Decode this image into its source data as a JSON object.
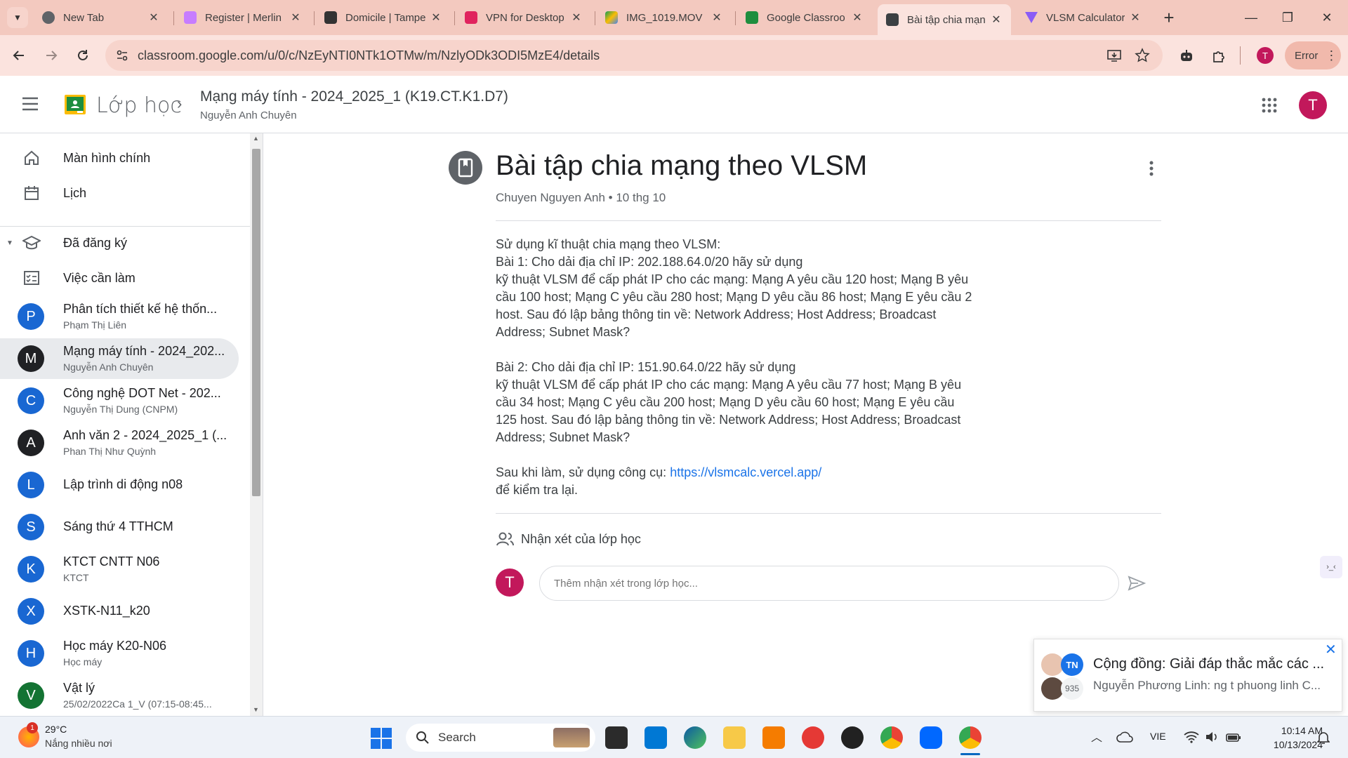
{
  "browser": {
    "tabs": [
      {
        "title": "New Tab",
        "color": "#5f6368"
      },
      {
        "title": "Register | Merlin",
        "color": "#c77dff"
      },
      {
        "title": "Domicile | Tampe",
        "color": "#333333"
      },
      {
        "title": "VPN for Desktop",
        "color": "#e0245e"
      },
      {
        "title": "IMG_1019.MOV",
        "color": "#fbbc04"
      },
      {
        "title": "Google Classroo",
        "color": "#1e8e3e"
      },
      {
        "title": "Bài tập chia mạn",
        "color": "#3c4043"
      },
      {
        "title": "VLSM Calculator",
        "color": "#8a5cf6"
      }
    ],
    "url": "classroom.google.com/u/0/c/NzEyNTI0NTk1OTMw/m/NzlyODk3ODI5MzE4/details",
    "profile_initial": "T",
    "error_label": "Error"
  },
  "header": {
    "brand": "Lớp học",
    "course_title": "Mạng máy tính - 2024_2025_1 (K19.CT.K1.D7)",
    "course_teacher": "Nguyễn Anh Chuyên",
    "user_initial": "T"
  },
  "sidebar": {
    "home": "Màn hình chính",
    "calendar": "Lịch",
    "enrolled": "Đã đăng ký",
    "todo": "Việc cần làm",
    "courses": [
      {
        "letter": "P",
        "name": "Phân tích thiết kế hệ thốn...",
        "teacher": "Phạm Thị Liên",
        "color": "#1967d2"
      },
      {
        "letter": "M",
        "name": "Mạng máy tính - 2024_202...",
        "teacher": "Nguyễn Anh Chuyên",
        "color": "#202124"
      },
      {
        "letter": "C",
        "name": "Công nghệ DOT Net - 202...",
        "teacher": "Nguyễn Thị Dung (CNPM)",
        "color": "#1967d2"
      },
      {
        "letter": "A",
        "name": "Anh văn 2 - 2024_2025_1 (...",
        "teacher": "Phan Thị Như Quỳnh",
        "color": "#202124"
      },
      {
        "letter": "L",
        "name": "Lập trình di động n08",
        "teacher": "",
        "color": "#1967d2"
      },
      {
        "letter": "S",
        "name": "Sáng thứ 4 TTHCM",
        "teacher": "",
        "color": "#1967d2"
      },
      {
        "letter": "K",
        "name": "KTCT CNTT N06",
        "teacher": "KTCT",
        "color": "#1967d2"
      },
      {
        "letter": "X",
        "name": "XSTK-N11_k20",
        "teacher": "",
        "color": "#1967d2"
      },
      {
        "letter": "H",
        "name": "Học máy K20-N06",
        "teacher": "Học máy",
        "color": "#1967d2"
      },
      {
        "letter": "V",
        "name": "Vật lý",
        "teacher": "25/02/2022Ca 1_V (07:15-08:45...",
        "color": "#137333"
      }
    ]
  },
  "assignment": {
    "title": "Bài tập chia mạng theo VLSM",
    "meta": "Chuyen Nguyen Anh • 10 thg 10",
    "intro": "Sử dụng kĩ thuật chia mạng theo VLSM:",
    "p1_line1": "Bài 1: Cho dải địa chỉ IP: 202.188.64.0/20 hãy sử dụng",
    "p1_line2": "kỹ thuật VLSM để cấp phát IP cho các mạng: Mạng A yêu cầu 120 host; Mạng B yêu cầu 100 host; Mạng C yêu cầu 280 host; Mạng D yêu cầu 86 host; Mạng E yêu cầu 2 host. Sau đó lập bảng thông tin về: Network Address; Host Address; Broadcast Address; Subnet Mask?",
    "p2_line1": "Bài 2: Cho dải địa chỉ IP: 151.90.64.0/22 hãy sử dụng",
    "p2_line2": "kỹ thuật VLSM để cấp phát IP cho các mạng: Mạng A yêu cầu 77 host; Mạng B yêu cầu 34 host; Mạng C yêu cầu 200 host; Mạng D yêu cầu 60 host; Mạng E yêu cầu 125 host. Sau đó lập bảng thông tin về: Network Address; Host Address; Broadcast Address; Subnet Mask?",
    "tool_prefix": "Sau khi làm, sử dụng công cụ: ",
    "tool_link": "https://vlsmcalc.vercel.app/",
    "tool_suffix": "để kiểm tra lại.",
    "comments_heading": "Nhận xét của lớp học",
    "comment_placeholder": "Thêm nhận xét trong lớp học...",
    "commenter_initial": "T"
  },
  "notification": {
    "title": "Cộng đồng: Giải đáp thắc mắc các ...",
    "message": "Nguyễn Phương Linh: ng t phuong linh C...",
    "badge_initials": "TN",
    "count": "935"
  },
  "taskbar": {
    "weather_temp": "29°C",
    "weather_desc": "Nắng nhiều nơi",
    "weather_badge": "1",
    "search": "Search",
    "language": "VIE",
    "time": "10:14 AM",
    "date": "10/13/2024"
  }
}
